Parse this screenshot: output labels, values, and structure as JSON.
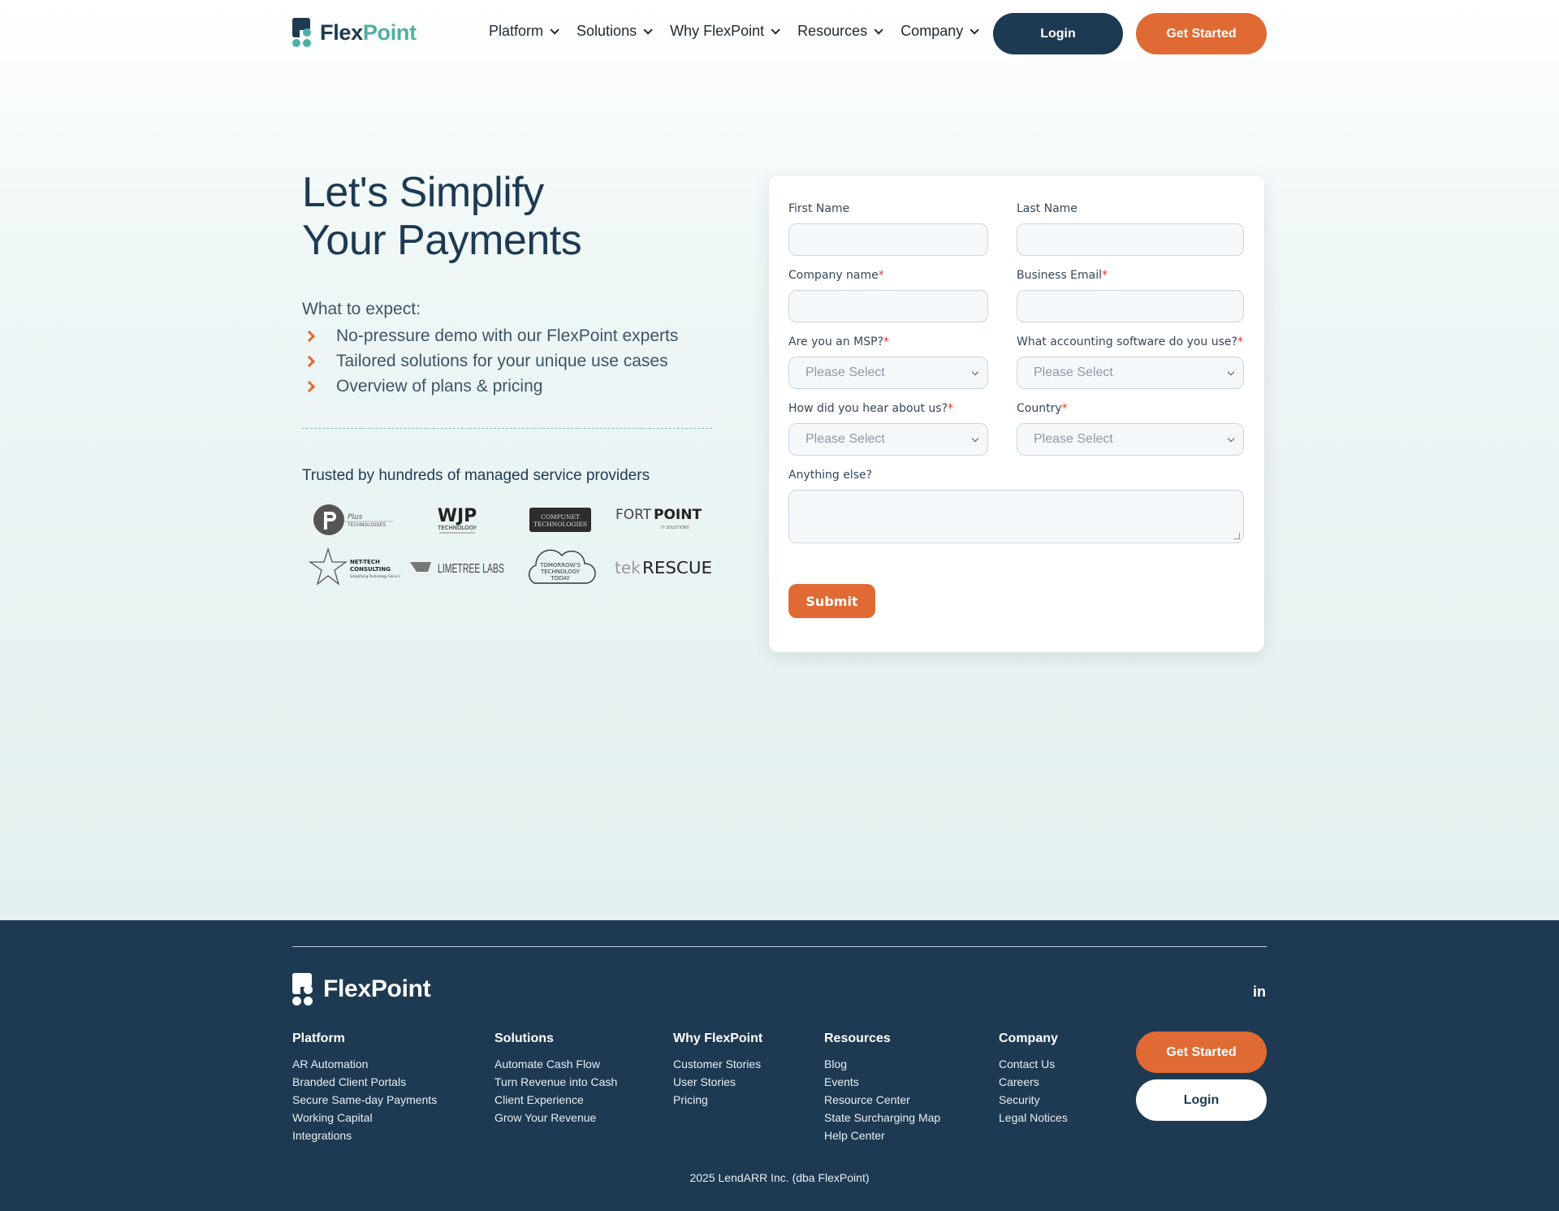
{
  "header": {
    "logo": {
      "part1": "Flex",
      "part2": "Point"
    },
    "nav": [
      {
        "label": "Platform"
      },
      {
        "label": "Solutions"
      },
      {
        "label": "Why FlexPoint"
      },
      {
        "label": "Resources"
      },
      {
        "label": "Company"
      }
    ],
    "login_label": "Login",
    "get_started_label": "Get Started"
  },
  "hero": {
    "title_line1": "Let's Simplify",
    "title_line2": "Your Payments",
    "expect_label": "What to expect:",
    "expect_items": [
      "No-pressure demo with our FlexPoint experts",
      "Tailored solutions for your unique use cases",
      "Overview of plans & pricing"
    ],
    "trusted_label": "Trusted by hundreds of managed service providers",
    "logos": [
      "Plus Technologies",
      "WJP Technology Consulting",
      "CompuNet Technologies",
      "FortPoint IT Solutions",
      "Net-Tech Consulting",
      "Limetree Labs",
      "Tomorrow's Technology Today",
      "tekRESCUE"
    ]
  },
  "form": {
    "first_name_label": "First Name",
    "last_name_label": "Last Name",
    "company_label": "Company name",
    "email_label": "Business Email",
    "msp_label": "Are you an MSP?",
    "accounting_label": "What accounting software do you use?",
    "hear_label": "How did you hear about us?",
    "country_label": "Country",
    "anything_label": "Anything else?",
    "select_placeholder": "Please Select",
    "required_mark": "*",
    "submit_label": "Submit"
  },
  "footer": {
    "logo_text": "FlexPoint",
    "linkedin": "in",
    "columns": [
      {
        "title": "Platform",
        "links": [
          "AR Automation",
          "Branded Client Portals",
          "Secure Same-day Payments",
          "Working Capital",
          "Integrations"
        ]
      },
      {
        "title": "Solutions",
        "links": [
          "Automate Cash Flow",
          "Turn Revenue into Cash",
          "Client Experience",
          "Grow Your Revenue"
        ]
      },
      {
        "title": "Why FlexPoint",
        "links": [
          "Customer Stories",
          "User Stories",
          "Pricing"
        ]
      },
      {
        "title": "Resources",
        "links": [
          "Blog",
          "Events",
          "Resource Center",
          "State Surcharging Map",
          "Help Center"
        ]
      },
      {
        "title": "Company",
        "links": [
          "Contact Us",
          "Careers",
          "Security",
          "Legal Notices"
        ]
      }
    ],
    "get_started_label": "Get Started",
    "login_label": "Login",
    "copyright": "2025 LendARR Inc. (dba FlexPoint)"
  },
  "colors": {
    "navy": "#1d3a52",
    "orange": "#e06a33",
    "teal": "#4db0a4"
  }
}
